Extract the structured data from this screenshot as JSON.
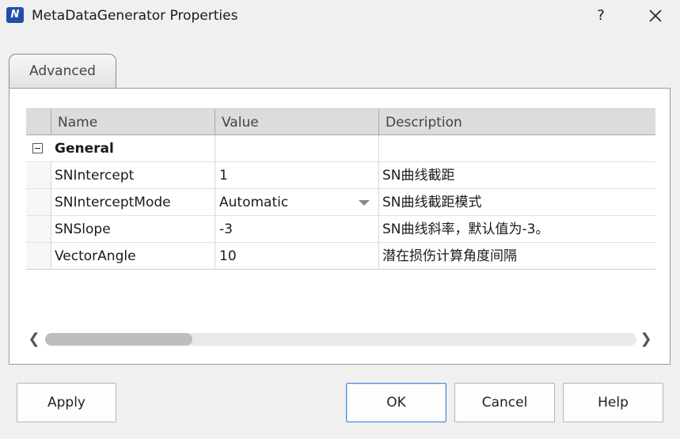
{
  "window": {
    "title": "MetaDataGenerator Properties",
    "icon_glyph": "N",
    "help_glyph": "?"
  },
  "tabs": [
    {
      "label": "Advanced",
      "active": true
    }
  ],
  "grid": {
    "columns": [
      "Name",
      "Value",
      "Description"
    ],
    "group": {
      "label": "General",
      "expanded": true
    },
    "rows": [
      {
        "name": "SNIntercept",
        "value": "1",
        "description": "SN曲线截距",
        "editor": "text"
      },
      {
        "name": "SNInterceptMode",
        "value": "Automatic",
        "description": "SN曲线截距模式",
        "editor": "dropdown"
      },
      {
        "name": "SNSlope",
        "value": "-3",
        "description": "SN曲线斜率，默认值为-3。",
        "editor": "text"
      },
      {
        "name": "VectorAngle",
        "value": "10",
        "description": "潜在损伤计算角度间隔",
        "editor": "text"
      }
    ]
  },
  "scrollbar": {
    "left_glyph": "❮",
    "right_glyph": "❯"
  },
  "buttons": {
    "apply": "Apply",
    "ok": "OK",
    "cancel": "Cancel",
    "help": "Help"
  },
  "colors": {
    "accent": "#4a90d9",
    "app_icon": "#1f4fa8"
  }
}
